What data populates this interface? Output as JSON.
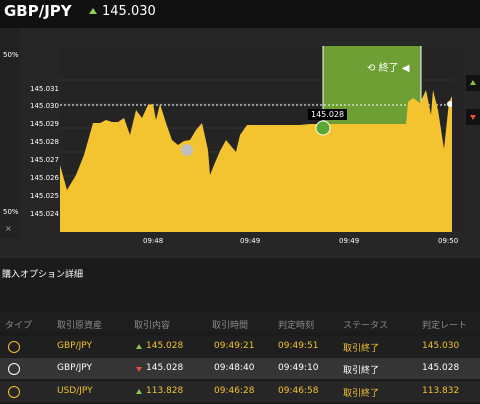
{
  "header": {
    "pair": "GBP/JPY",
    "rate": "145.030"
  },
  "chart": {
    "left_percent_top": "50%",
    "left_percent_bottom": "50%",
    "close_label": "×",
    "price_ticks": [
      "145.031",
      "145.030",
      "145.029",
      "145.028",
      "145.027",
      "145.026",
      "145.025",
      "145.024"
    ],
    "time_ticks": [
      "09:48",
      "09:49",
      "09:49",
      "09:50"
    ],
    "entry_label": "145.028",
    "end_label": "終了"
  },
  "details": {
    "title": "購入オプション詳細",
    "headers": [
      "タイプ",
      "取引原資産",
      "取引内容",
      "取引時間",
      "判定時刻",
      "ステータス",
      "判定レート"
    ],
    "rows": [
      {
        "asset": "GBP/JPY",
        "direction": "up",
        "entry": "145.028",
        "time": "09:49:21",
        "judge": "09:49:51",
        "status": "取引終了",
        "rate": "145.030"
      },
      {
        "asset": "GBP/JPY",
        "direction": "down",
        "entry": "145.028",
        "time": "09:48:40",
        "judge": "09:49:10",
        "status": "取引終了",
        "rate": "145.028"
      },
      {
        "asset": "USD/JPY",
        "direction": "up",
        "entry": "113.828",
        "time": "09:46:28",
        "judge": "09:46:58",
        "status": "取引終了",
        "rate": "113.832"
      }
    ]
  }
}
